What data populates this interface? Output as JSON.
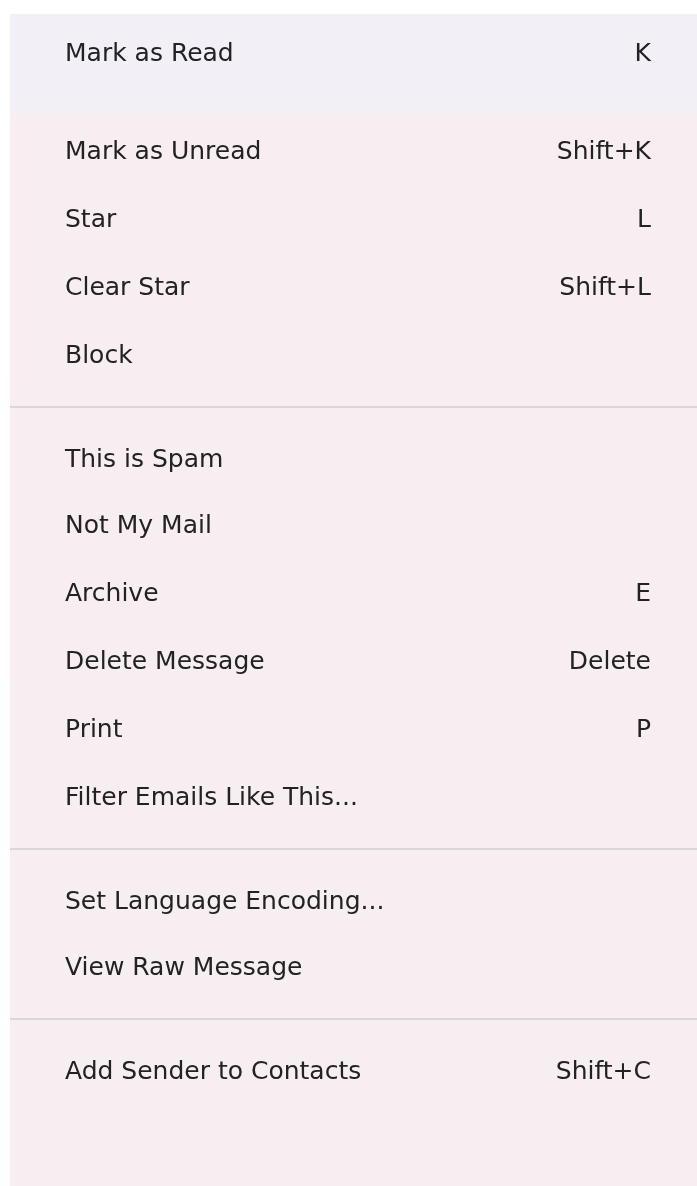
{
  "menu": {
    "groups": [
      {
        "items": [
          {
            "label": "Mark as Read",
            "shortcut": "K"
          },
          {
            "label": "Mark as Unread",
            "shortcut": "Shift+K"
          },
          {
            "label": "Star",
            "shortcut": "L"
          },
          {
            "label": "Clear Star",
            "shortcut": "Shift+L"
          },
          {
            "label": "Block"
          }
        ]
      },
      {
        "items": [
          {
            "label": "This is Spam"
          },
          {
            "label": "Not My Mail"
          },
          {
            "label": "Archive",
            "shortcut": "E"
          },
          {
            "label": "Delete Message",
            "shortcut": "Delete"
          },
          {
            "label": "Print",
            "shortcut": "P"
          },
          {
            "label": "Filter Emails Like This..."
          }
        ]
      },
      {
        "items": [
          {
            "label": "Set Language Encoding..."
          },
          {
            "label": "View Raw Message"
          }
        ]
      },
      {
        "items": [
          {
            "label": "Add Sender to Contacts",
            "shortcut": "Shift+C"
          }
        ]
      }
    ]
  }
}
